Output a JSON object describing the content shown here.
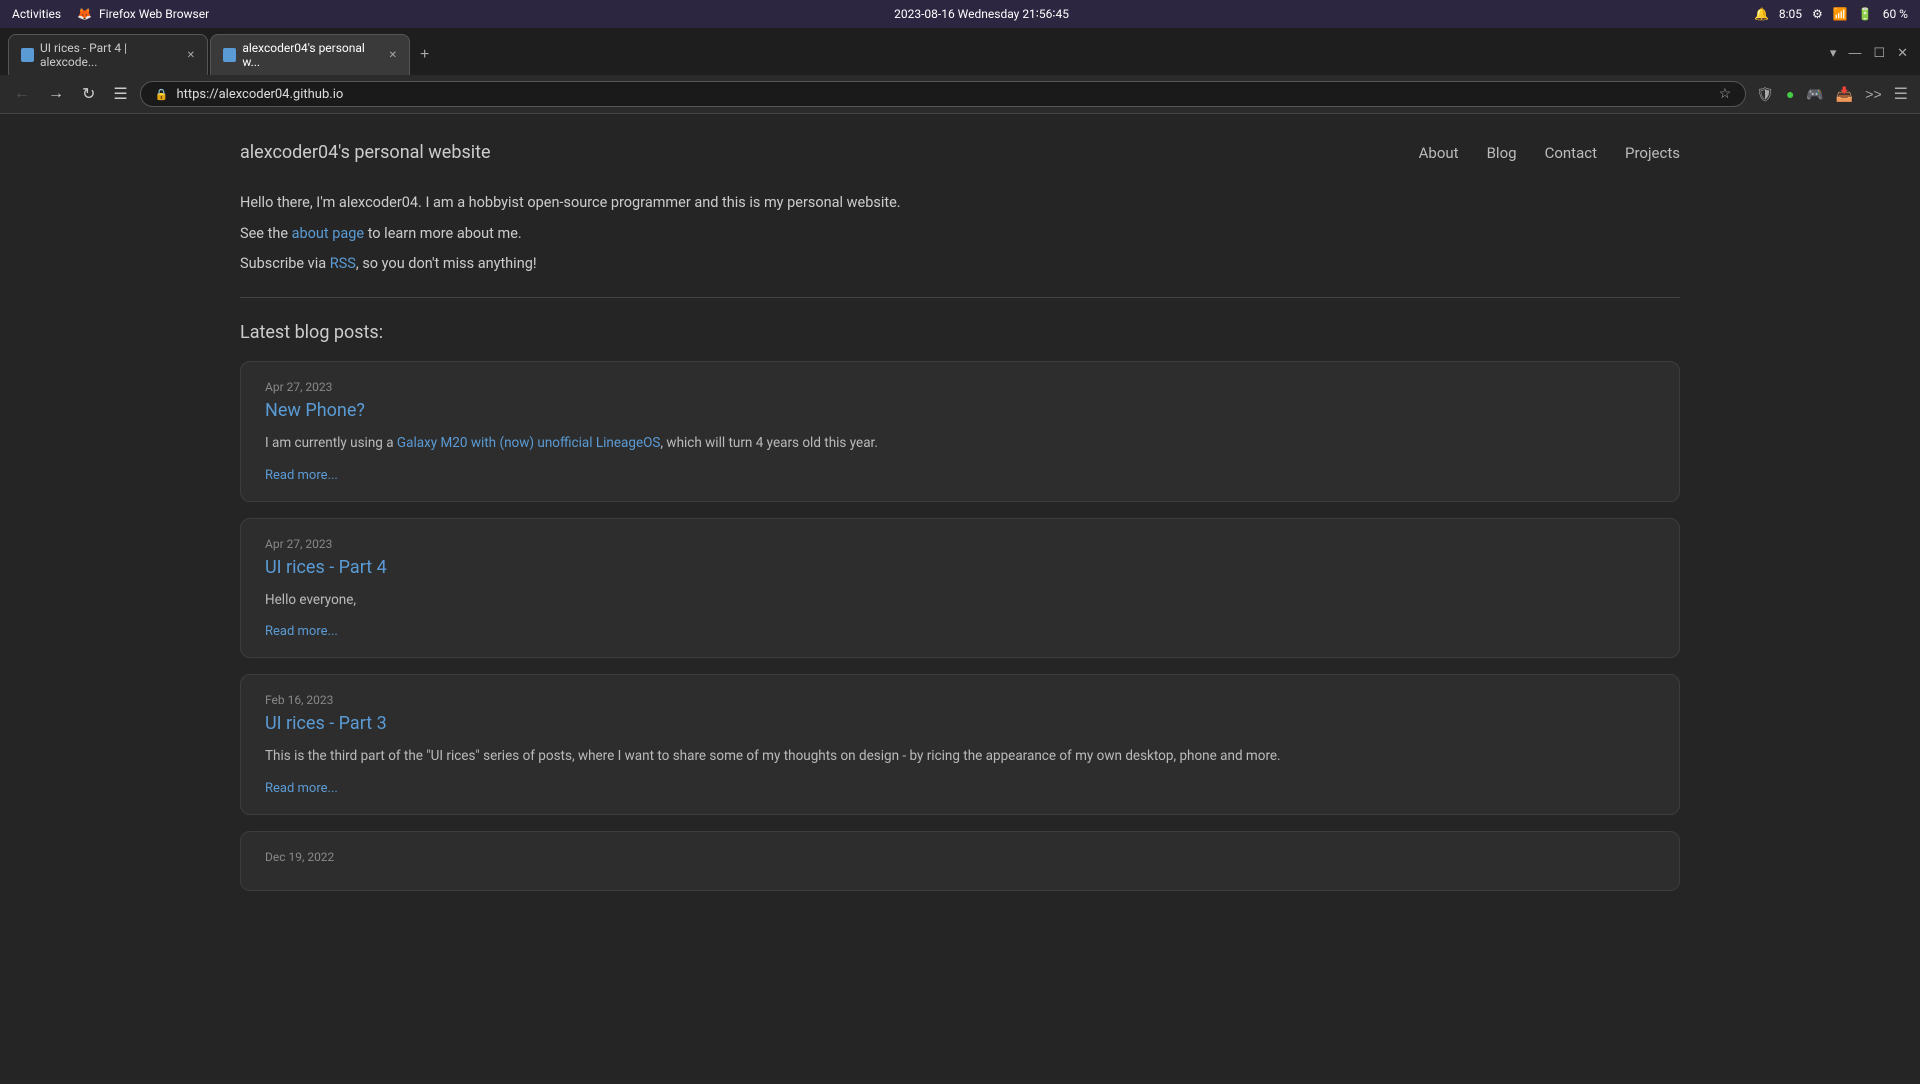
{
  "os_bar": {
    "activities": "Activities",
    "browser_label": "Firefox Web Browser",
    "datetime": "2023-08-16 Wednesday 21∶56∶45",
    "battery": "60 %",
    "time": "8:05"
  },
  "browser": {
    "tabs": [
      {
        "id": "tab1",
        "label": "UI rices - Part 4 | alexcode...",
        "active": false,
        "url": ""
      },
      {
        "id": "tab2",
        "label": "alexcoder04's personal w...",
        "active": true,
        "url": ""
      }
    ],
    "url": "https://alexcoder04.github.io"
  },
  "site": {
    "title": "alexcoder04's personal website",
    "nav": {
      "about": "About",
      "blog": "Blog",
      "contact": "Contact",
      "projects": "Projects"
    },
    "intro": {
      "line1": "Hello there, I'm alexcoder04. I am a hobbyist open-source programmer and this is my personal website.",
      "line2_prefix": "See the ",
      "line2_link": "about page",
      "line2_suffix": " to learn more about me.",
      "line3_prefix": "Subscribe via ",
      "line3_link": "RSS",
      "line3_suffix": ", so you don't miss anything!"
    },
    "section_title": "Latest blog posts:",
    "posts": [
      {
        "date": "Apr 27, 2023",
        "title": "New Phone?",
        "excerpt_prefix": "I am currently using a ",
        "excerpt_link": "Galaxy M20 with (now) unofficial LineageOS",
        "excerpt_suffix": ", which will turn 4 years old this year.",
        "read_more": "Read more..."
      },
      {
        "date": "Apr 27, 2023",
        "title": "UI rices - Part 4",
        "excerpt_prefix": "Hello everyone,",
        "excerpt_link": "",
        "excerpt_suffix": "",
        "read_more": "Read more..."
      },
      {
        "date": "Feb 16, 2023",
        "title": "UI rices - Part 3",
        "excerpt_prefix": "This is the third part of the \"UI rices\" series of posts, where I want to share some of my thoughts on design - by ricing the appearance of my own desktop, phone and more.",
        "excerpt_link": "",
        "excerpt_suffix": "",
        "read_more": "Read more..."
      },
      {
        "date": "Dec 19, 2022",
        "title": "",
        "excerpt_prefix": "",
        "excerpt_link": "",
        "excerpt_suffix": "",
        "read_more": ""
      }
    ]
  }
}
